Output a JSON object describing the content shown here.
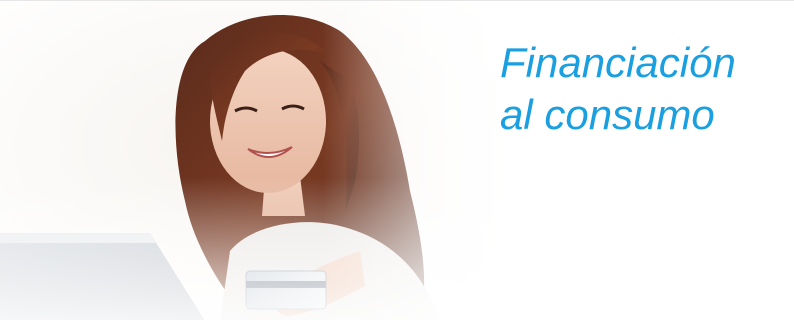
{
  "banner": {
    "headline_line1": "Financiación",
    "headline_line2": "al consumo",
    "headline_color": "#1a9fe0",
    "photo_subject": "woman-with-laptop-and-credit-card"
  }
}
